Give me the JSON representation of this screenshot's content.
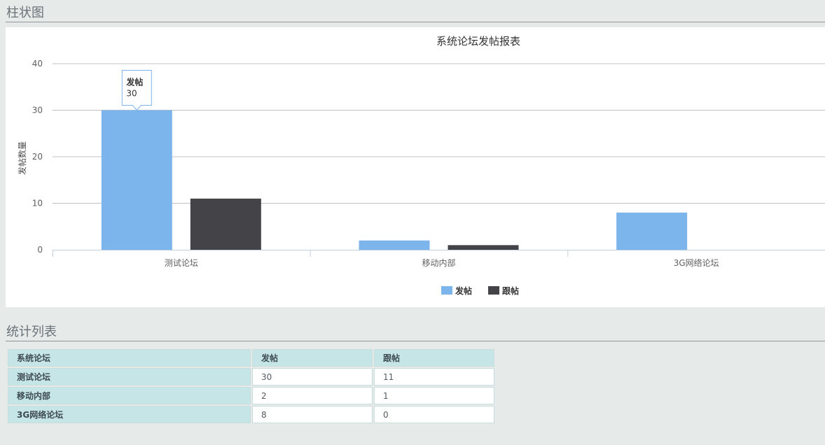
{
  "sections": {
    "chart_title": "柱状图",
    "table_title": "统计列表"
  },
  "chart_data": {
    "type": "bar",
    "title": "系统论坛发帖报表",
    "ylabel": "发帖数量",
    "xlabel": "",
    "ylim": [
      0,
      40
    ],
    "yticks": [
      0,
      10,
      20,
      30,
      40
    ],
    "categories": [
      "测试论坛",
      "移动内部",
      "3G网络论坛"
    ],
    "series": [
      {
        "name": "发帖",
        "values": [
          30,
          2,
          8
        ],
        "color": "#7cb5ec"
      },
      {
        "name": "跟帖",
        "values": [
          11,
          1,
          0
        ],
        "color": "#434348"
      }
    ],
    "legend": "bottom-center",
    "grid": true,
    "tooltip": {
      "series": "发帖",
      "value": "30",
      "category_index": 0
    }
  },
  "table": {
    "headers": [
      "系统论坛",
      "发帖",
      "跟帖"
    ],
    "rows": [
      [
        "测试论坛",
        "30",
        "11"
      ],
      [
        "移动内部",
        "2",
        "1"
      ],
      [
        "3G网络论坛",
        "8",
        "0"
      ]
    ]
  }
}
